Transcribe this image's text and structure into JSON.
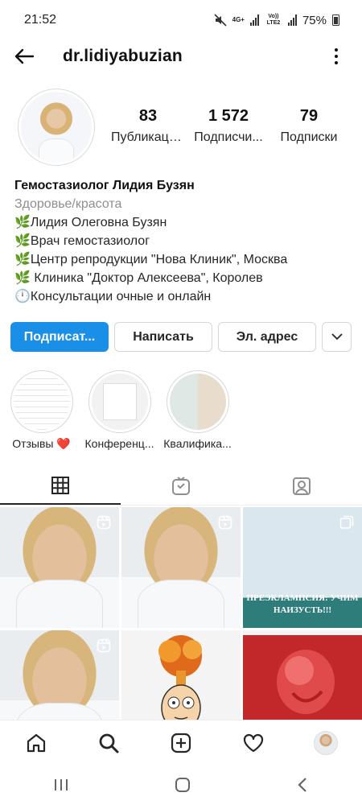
{
  "status_bar": {
    "time": "21:52",
    "network_label": "4G+",
    "volte_label": "Vo)) LTE2",
    "battery": "75%",
    "icons": [
      "mute-icon",
      "signal-icon",
      "battery-icon"
    ]
  },
  "header": {
    "username": "dr.lidiyabuzian",
    "back_icon": "arrow-left-icon",
    "more_icon": "more-vertical-icon"
  },
  "profile": {
    "stats": [
      {
        "value": "83",
        "label": "Публикаци..."
      },
      {
        "value": "1 572",
        "label": "Подписчи..."
      },
      {
        "value": "79",
        "label": "Подписки"
      }
    ],
    "name": "Гемостазиолог Лидия Бузян",
    "category": "Здоровье/красота",
    "bio_lines": [
      "🌿Лидия Олеговна Бузян",
      "🌿Врач гемостазиолог",
      "🌿Центр репродукции \"Нова Клиник\", Москва",
      "🌿 Клиника \"Доктор Алексеева\", Королев",
      "🕛Консультации очные и онлайн"
    ]
  },
  "actions": {
    "follow": "Подписат...",
    "message": "Написать",
    "email": "Эл. адрес",
    "more_icon": "chevron-down-icon"
  },
  "highlights": [
    {
      "label": "Отзывы ❤️"
    },
    {
      "label": "Конференц..."
    },
    {
      "label": "Квалифика..."
    }
  ],
  "tabs": [
    "grid-icon",
    "igtv-icon",
    "tagged-icon"
  ],
  "grid": {
    "posts": [
      {
        "kind": "reel"
      },
      {
        "kind": "reel"
      },
      {
        "kind": "image",
        "caption": "ПРЕЭКЛАМПСИЯ: УЧИМ НАИЗУСТЬ!!!"
      },
      {
        "kind": "reel"
      },
      {
        "kind": "image",
        "caption": ""
      },
      {
        "kind": "image",
        "caption": ""
      }
    ]
  },
  "bottom_nav": [
    "home-icon",
    "search-icon",
    "new-post-icon",
    "activity-heart-icon",
    "profile-avatar"
  ],
  "colors": {
    "accent": "#1a8fe8",
    "text": "#262626",
    "muted": "#8e8e8e"
  }
}
